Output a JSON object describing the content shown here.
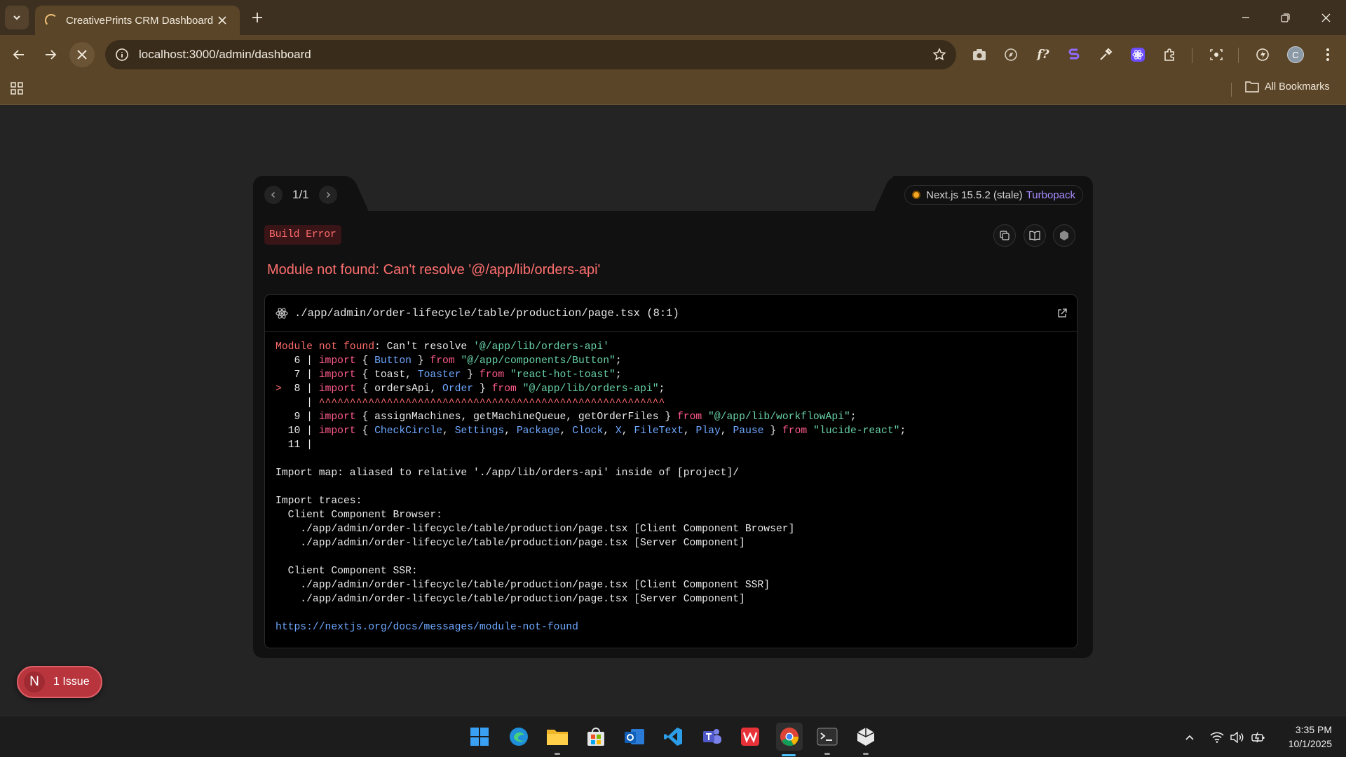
{
  "browser": {
    "tab_title": "CreativePrints CRM Dashboard",
    "url": "localhost:3000/admin/dashboard",
    "bookmarks_label": "All Bookmarks",
    "profile_initial": "C"
  },
  "overlay": {
    "pager": "1/1",
    "version_label": "Next.js 15.5.2 (stale)",
    "bundler": "Turbopack",
    "badge": "Build Error",
    "error_title": "Module not found: Can't resolve '@/app/lib/orders-api'",
    "file_ref": "./app/admin/order-lifecycle/table/production/page.tsx (8:1)",
    "code": {
      "head_label": "Module not found",
      "head_rest": ": Can't resolve ",
      "head_module": "'@/app/lib/orders-api'",
      "line6_num": "6",
      "line7_num": "7",
      "line8_num": "8",
      "line9_num": "9",
      "line10_num": "10",
      "line11_num": "11",
      "caret": "^^^^^^^^^^^^^^^^^^^^^^^^^^^^^^^^^^^^^^^^^^^^^^^^^^^^^^^^",
      "import_map": "Import map: aliased to relative './app/lib/orders-api' inside of [project]/",
      "import_traces": "Import traces:",
      "ccb_label": "Client Component Browser:",
      "ccb_1": "./app/admin/order-lifecycle/table/production/page.tsx [Client Component Browser]",
      "ccb_2": "./app/admin/order-lifecycle/table/production/page.tsx [Server Component]",
      "ssr_label": "Client Component SSR:",
      "ssr_1": "./app/admin/order-lifecycle/table/production/page.tsx [Client Component SSR]",
      "ssr_2": "./app/admin/order-lifecycle/table/production/page.tsx [Server Component]",
      "docs_link": "https://nextjs.org/docs/messages/module-not-found"
    }
  },
  "issue_pill": {
    "letter": "N",
    "label": "1 Issue"
  },
  "taskbar": {
    "time": "3:35 PM",
    "date": "10/1/2025"
  },
  "colors": {
    "error_red": "#ff6f6f",
    "turbopack": "#a98cff",
    "link": "#6ea8ff",
    "chrome_frame": "#5b4528"
  }
}
